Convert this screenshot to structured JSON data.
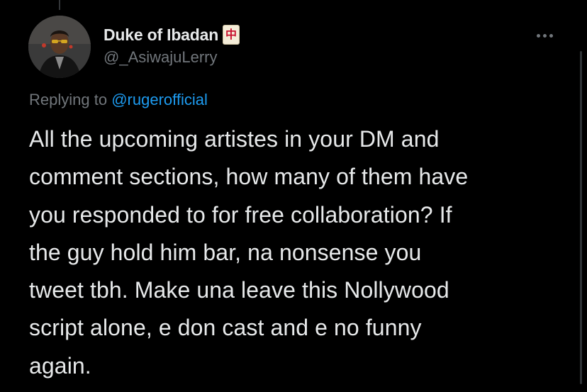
{
  "author": {
    "display_name": "Duke of Ibadan",
    "name_emoji": "中",
    "handle": "@_AsiwajuLerry"
  },
  "reply": {
    "prefix": "Replying to",
    "mention": "@rugerofficial"
  },
  "tweet": {
    "lines": [
      "All the upcoming artistes in your DM and",
      "comment sections, how many of them have",
      "you responded to for free collaboration? If",
      "the guy hold him bar, na nonsense you",
      "tweet tbh. Make una leave this Nollywood",
      "script alone, e don cast and e no funny",
      "again."
    ]
  },
  "icons": {
    "more": "more-horizontal-icon",
    "avatar": "profile-avatar",
    "emoji": "mahjong-red-dragon-emoji"
  },
  "colors": {
    "background": "#000000",
    "text_primary": "#e7e9ea",
    "text_secondary": "#71767b",
    "link": "#1d9bf0"
  }
}
